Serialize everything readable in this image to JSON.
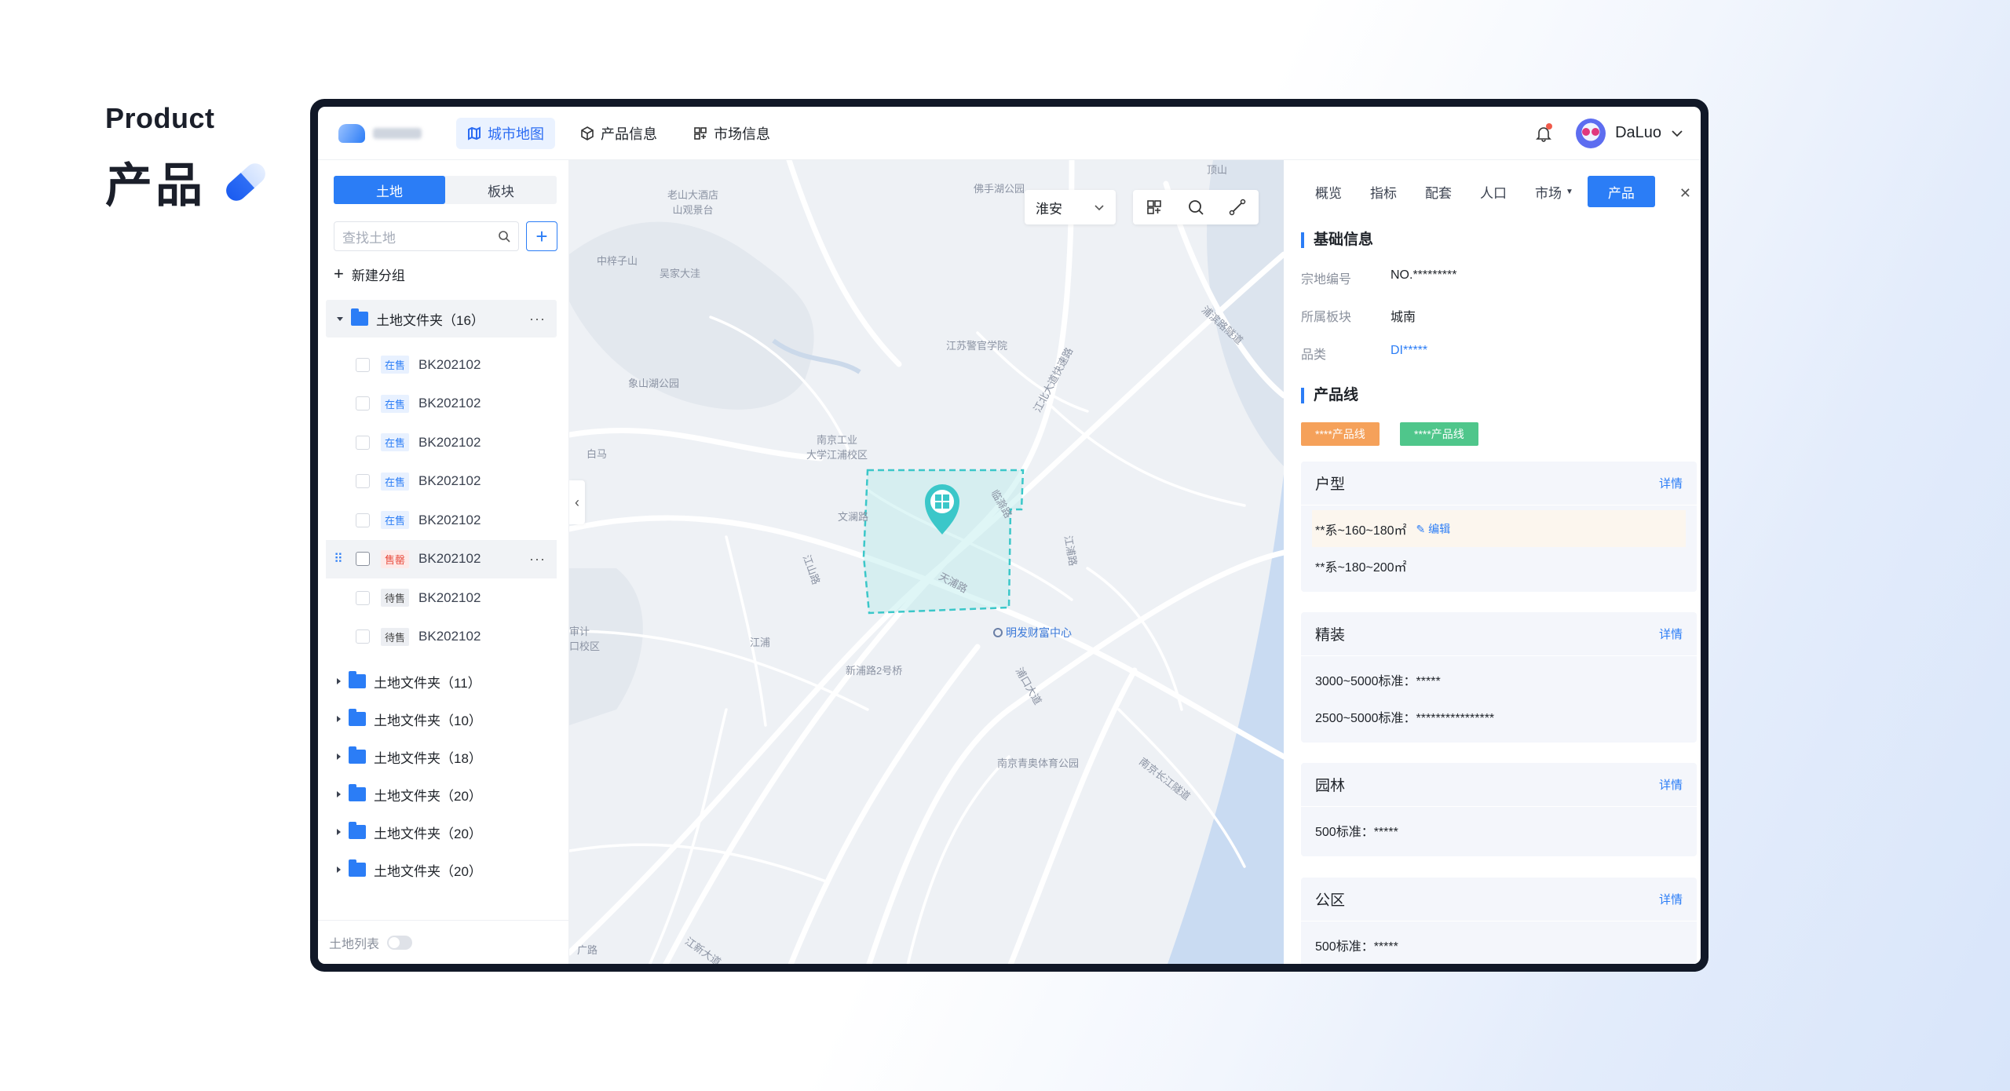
{
  "hero": {
    "en": "Product",
    "zh": "产品"
  },
  "nav": {
    "items": [
      {
        "label": "城市地图",
        "active": true
      },
      {
        "label": "产品信息",
        "active": false
      },
      {
        "label": "市场信息",
        "active": false
      }
    ],
    "user": "DaLuo"
  },
  "sidebar": {
    "seg": [
      "土地",
      "板块"
    ],
    "search_placeholder": "查找土地",
    "new_group": "新建分组",
    "open_folder": "土地文件夹（16）",
    "items": [
      {
        "status": "在售",
        "code": "BK202102"
      },
      {
        "status": "在售",
        "code": "BK202102"
      },
      {
        "status": "在售",
        "code": "BK202102"
      },
      {
        "status": "在售",
        "code": "BK202102"
      },
      {
        "status": "在售",
        "code": "BK202102"
      },
      {
        "status": "售罄",
        "code": "BK202102"
      },
      {
        "status": "待售",
        "code": "BK202102"
      },
      {
        "status": "待售",
        "code": "BK202102"
      }
    ],
    "folders": [
      "土地文件夹（11）",
      "土地文件夹（10）",
      "土地文件夹（18）",
      "土地文件夹（20）",
      "土地文件夹（20）",
      "土地文件夹（20）"
    ],
    "footer": "土地列表"
  },
  "map": {
    "city": "淮安",
    "labels": {
      "l1": "老山大酒店\n山观景台",
      "l2": "中梓子山",
      "l3": "吴家大洼",
      "l4": "江苏警官学院",
      "l5": "象山湖公园",
      "l6": "南京工业\n大学江浦校区",
      "l7": "白马",
      "l8": "文澜路",
      "l9": "江浦",
      "l10": "新浦路2号桥",
      "l11": "南京青奥体育公园",
      "l12": "临滁路",
      "l13": "天浦路",
      "l14": "浦口大道",
      "l15": "南京长江隧道",
      "l16": "审计\n口校区",
      "l17": "顶山",
      "l18": "佛手湖公园",
      "l19": "江北大道快速路",
      "l20": "浦滨路隧道",
      "l21": "江山路",
      "l22": "江浦路",
      "l23": "江新大道",
      "l24": "广路",
      "poi": "明发财富中心"
    }
  },
  "panel": {
    "tabs": [
      "概览",
      "指标",
      "配套",
      "人口",
      "市场",
      "产品"
    ],
    "basic_title": "基础信息",
    "basic": [
      {
        "k": "宗地编号",
        "v": "NO.*********"
      },
      {
        "k": "所属板块",
        "v": "城南"
      },
      {
        "k": "品类",
        "v": "DI*****"
      }
    ],
    "pl_title": "产品线",
    "pl_tags": [
      "****产品线",
      "****产品线"
    ],
    "detail": "详情",
    "edit": "编辑",
    "cards": [
      {
        "title": "户型",
        "rows": [
          "**系~160~180㎡",
          "**系~180~200㎡"
        ]
      },
      {
        "title": "精装",
        "rows": [
          "3000~5000标准：*****",
          "2500~5000标准：****************"
        ]
      },
      {
        "title": "园林",
        "rows": [
          "500标准：*****"
        ]
      },
      {
        "title": "公区",
        "rows": [
          "500标准：*****"
        ]
      }
    ]
  },
  "colors": {
    "accent": "#2b7df6",
    "orange": "#f5a15a",
    "green": "#4fc68b",
    "zone": "#3bc7c9"
  }
}
